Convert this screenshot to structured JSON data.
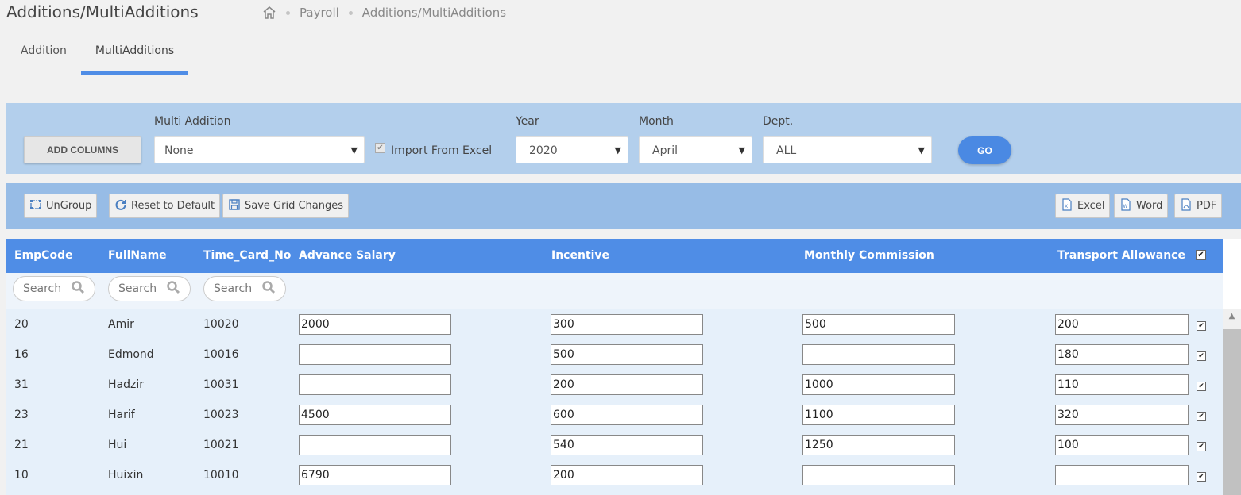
{
  "header": {
    "title": "Additions/MultiAdditions",
    "breadcrumb": [
      "Payroll",
      "Additions/MultiAdditions"
    ]
  },
  "tabs": [
    {
      "label": "Addition",
      "active": false
    },
    {
      "label": "MultiAdditions",
      "active": true
    }
  ],
  "filters": {
    "add_columns_label": "ADD COLUMNS",
    "multi_addition_label": "Multi Addition",
    "multi_addition_value": "None",
    "import_label": "Import From Excel",
    "year_label": "Year",
    "year_value": "2020",
    "month_label": "Month",
    "month_value": "April",
    "dept_label": "Dept.",
    "dept_value": "ALL",
    "go_label": "GO"
  },
  "toolbar": {
    "ungroup": "UnGroup",
    "reset": "Reset to Default",
    "save": "Save Grid Changes",
    "excel": "Excel",
    "word": "Word",
    "pdf": "PDF"
  },
  "grid": {
    "columns": [
      "EmpCode",
      "FullName",
      "Time_Card_No",
      "Advance Salary",
      "Incentive",
      "Monthly Commission",
      "Transport Allowance"
    ],
    "search_placeholder": "Search",
    "rows": [
      {
        "code": "20",
        "name": "Amir",
        "card": "10020",
        "advance": "2000",
        "incentive": "300",
        "commission": "500",
        "transport": "200"
      },
      {
        "code": "16",
        "name": "Edmond",
        "card": "10016",
        "advance": "",
        "incentive": "500",
        "commission": "",
        "transport": "180"
      },
      {
        "code": "31",
        "name": "Hadzir",
        "card": "10031",
        "advance": "",
        "incentive": "200",
        "commission": "1000",
        "transport": "110"
      },
      {
        "code": "23",
        "name": "Harif",
        "card": "10023",
        "advance": "4500",
        "incentive": "600",
        "commission": "1100",
        "transport": "320"
      },
      {
        "code": "21",
        "name": "Hui",
        "card": "10021",
        "advance": "",
        "incentive": "540",
        "commission": "1250",
        "transport": "100"
      },
      {
        "code": "10",
        "name": "Huixin",
        "card": "10010",
        "advance": "6790",
        "incentive": "200",
        "commission": "",
        "transport": ""
      }
    ]
  }
}
